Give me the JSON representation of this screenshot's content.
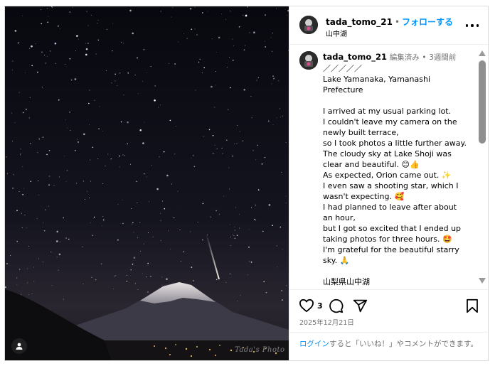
{
  "post": {
    "username": "tada_tomo_21",
    "follow_label": "フォローする",
    "separator": "•",
    "location": "山中湖",
    "watermark": "Tada's Photo",
    "more_icon": "more-horizontal-icon"
  },
  "comment": {
    "username": "tada_tomo_21",
    "edited": "編集済み",
    "separator": "•",
    "time": "3週間前",
    "caption": "／／／／／\nLake Yamanaka, Yamanashi Prefecture\n\nI arrived at my usual parking lot.\nI couldn't leave my camera on the newly built terrace,\nso I took photos a little further away.\nThe cloudy sky at Lake Shoji was clear and beautiful. 😊👍\nAs expected, Orion came out. ✨\nI even saw a shooting star, which I wasn't expecting. 🥰\nI had planned to leave after about an hour,\nbut I got so excited that I ended up taking photos for three hours. 🤩\nI'm grateful for the beautiful starry sky. 🙏\n\n山梨県山中湖"
  },
  "actions": {
    "like_count": "3",
    "date": "2025年12月21日",
    "icons": [
      "heart-icon",
      "comment-icon",
      "share-icon",
      "bookmark-icon"
    ]
  },
  "login": {
    "link": "ログイン",
    "text": "すると「いいね！」やコメントができます。"
  },
  "colors": {
    "accent": "#0095f6",
    "secondary_text": "#737373",
    "border": "#dbdbdb"
  }
}
